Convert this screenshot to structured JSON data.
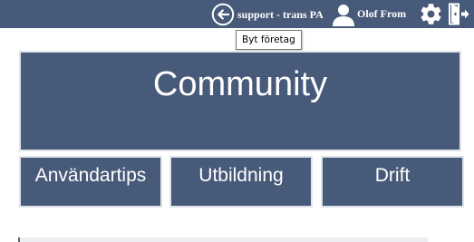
{
  "header": {
    "company_switch": {
      "icon": "arrow-left-circle-icon",
      "label": "support - trans PA",
      "tooltip": "Byt företag"
    },
    "user": {
      "icon": "user-icon",
      "name": "Olof From"
    },
    "settings_icon": "gear-icon",
    "logout_icon": "logout-icon"
  },
  "main": {
    "hero_tile": {
      "label": "Community"
    },
    "tiles": [
      {
        "label": "Användartips"
      },
      {
        "label": "Utbildning"
      },
      {
        "label": "Drift"
      }
    ]
  },
  "colors": {
    "header_bg": "#485a79",
    "tile_bg": "#485a79",
    "tile_border": "#dfe3ea",
    "text_on_dark": "#ffffff"
  }
}
